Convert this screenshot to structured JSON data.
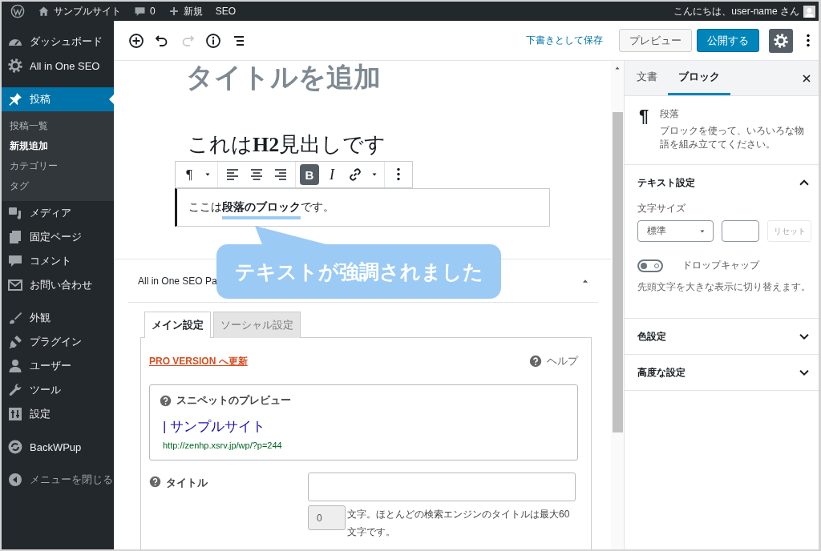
{
  "admin_bar": {
    "site_name": "サンプルサイト",
    "comments": "0",
    "new_label": "新規",
    "seo_label": "SEO",
    "greeting": "こんにちは、user-name さん"
  },
  "sidebar": {
    "groups": [
      {
        "items": [
          {
            "label": "ダッシュボード",
            "selected": false
          },
          {
            "label": "All in One SEO",
            "selected": false
          }
        ]
      },
      {
        "items": [
          {
            "label": "投稿",
            "selected": true,
            "submenu": [
              {
                "label": "投稿一覧",
                "selected": false
              },
              {
                "label": "新規追加",
                "selected": true
              },
              {
                "label": "カテゴリー",
                "selected": false
              },
              {
                "label": "タグ",
                "selected": false
              }
            ]
          },
          {
            "label": "メディア",
            "selected": false
          },
          {
            "label": "固定ページ",
            "selected": false
          },
          {
            "label": "コメント",
            "selected": false
          },
          {
            "label": "お問い合わせ",
            "selected": false
          }
        ]
      },
      {
        "items": [
          {
            "label": "外観",
            "selected": false
          },
          {
            "label": "プラグイン",
            "selected": false
          },
          {
            "label": "ユーザー",
            "selected": false
          },
          {
            "label": "ツール",
            "selected": false
          },
          {
            "label": "設定",
            "selected": false
          }
        ]
      },
      {
        "items": [
          {
            "label": "BackWPup",
            "selected": false
          }
        ]
      }
    ],
    "collapse_label": "メニューを閉じる"
  },
  "editor_header": {
    "tools": [
      {
        "kind": "add",
        "disabled": false
      },
      {
        "kind": "undo",
        "disabled": false
      },
      {
        "kind": "redo",
        "disabled": true
      },
      {
        "kind": "info",
        "disabled": false
      },
      {
        "kind": "outline",
        "disabled": false
      }
    ],
    "save_draft": "下書きとして保存",
    "preview": "プレビュー",
    "publish": "公開する",
    "settings_pressed": true
  },
  "editor": {
    "title": "タイトルを追加",
    "heading": "これは**H2**見出しです",
    "paragraph": "ここは**段落のブロック**です。",
    "block_toolbar": [
      [
        {
          "kind": "paragraph",
          "label": "¶",
          "pressed": false
        },
        {
          "kind": "caret",
          "pressed": false
        }
      ],
      [
        {
          "kind": "align-left",
          "pressed": false
        },
        {
          "kind": "align-center",
          "pressed": false
        },
        {
          "kind": "align-right",
          "pressed": false
        }
      ],
      [
        {
          "kind": "bold",
          "label": "B",
          "pressed": true
        },
        {
          "kind": "italic",
          "label": "I",
          "pressed": false
        },
        {
          "kind": "link",
          "pressed": false
        },
        {
          "kind": "caret",
          "pressed": false
        }
      ],
      [
        {
          "kind": "more",
          "pressed": false
        }
      ]
    ],
    "callout": "テキストが強調されました"
  },
  "seo_box": {
    "title": "All in One SEO Pa",
    "expanded": true,
    "tabs": [
      {
        "label": "メイン設定",
        "selected": true
      },
      {
        "label": "ソーシャル設定",
        "selected": false
      }
    ],
    "pro_link": "PRO VERSION へ更新",
    "help": "ヘルプ",
    "snippet": {
      "heading": "スニペットのプレビュー",
      "title": "| サンプルサイト",
      "url": "http://zenhp.xsrv.jp/wp/?p=244"
    },
    "title_field": {
      "label": "タイトル",
      "count": "0",
      "note": "文字。ほとんどの検索エンジンのタイトルは最大60文字です。"
    }
  },
  "settings_panel": {
    "tabs": [
      {
        "label": "文書",
        "selected": false
      },
      {
        "label": "ブロック",
        "selected": true
      }
    ],
    "block": {
      "icon": "¶",
      "name": "段落",
      "description": "ブロックを使って、いろいろな物語を組み立ててください。"
    },
    "sections": [
      {
        "title": "テキスト設定",
        "expanded": true
      },
      {
        "title": "色設定",
        "expanded": false
      },
      {
        "title": "高度な設定",
        "expanded": false
      }
    ],
    "font_size": {
      "label": "文字サイズ",
      "value": "標準",
      "reset": "リセット",
      "reset_disabled": true
    },
    "drop_cap": {
      "label": "ドロップキャップ",
      "on": false,
      "help": "先頭文字を大きな表示に切り替えます。"
    }
  }
}
